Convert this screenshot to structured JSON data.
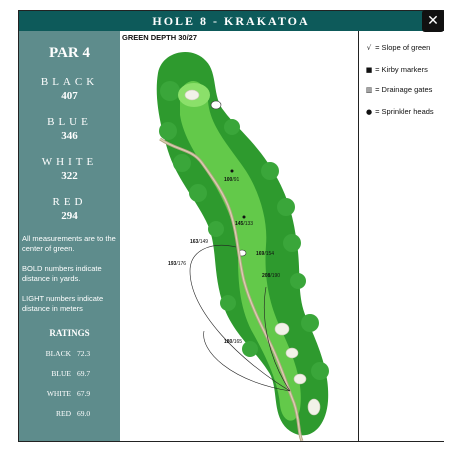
{
  "header": {
    "title": "HOLE 8 - KRAKATOA",
    "close_label": "✕"
  },
  "sidebar": {
    "par": "PAR 4",
    "tees": [
      {
        "name": "BLACK",
        "yards": "407"
      },
      {
        "name": "BLUE",
        "yards": "346"
      },
      {
        "name": "WHITE",
        "yards": "322"
      },
      {
        "name": "RED",
        "yards": "294"
      }
    ],
    "notes": [
      "All measurements are to the center of green.",
      "BOLD numbers indicate distance in yards.",
      "LIGHT numbers indicate distance in meters"
    ],
    "ratings_title": "RATINGS",
    "ratings": [
      {
        "name": "BLACK",
        "value": "72.3"
      },
      {
        "name": "BLUE",
        "value": "69.7"
      },
      {
        "name": "WHITE",
        "value": "67.9"
      },
      {
        "name": "RED",
        "value": "69.0"
      }
    ]
  },
  "map": {
    "green_depth": "GREEN DEPTH 30/27",
    "distances": [
      {
        "label": "100",
        "sub": "/91"
      },
      {
        "label": "145",
        "sub": "/133"
      },
      {
        "label": "163",
        "sub": "/149"
      },
      {
        "label": "193",
        "sub": "/176"
      },
      {
        "label": "169",
        "sub": "/154"
      },
      {
        "label": "208",
        "sub": "/190"
      },
      {
        "label": "180",
        "sub": "/165"
      }
    ]
  },
  "legend": {
    "items": [
      {
        "icon": "slope-icon",
        "symbol": "√",
        "label": "= Slope of green"
      },
      {
        "icon": "kirby-marker-icon",
        "symbol": "■",
        "label": "= Kirby markers"
      },
      {
        "icon": "drainage-gate-icon",
        "symbol": "▥",
        "label": "= Drainage gates"
      },
      {
        "icon": "sprinkler-head-icon",
        "symbol": "●",
        "label": "= Sprinkler heads"
      }
    ]
  },
  "colors": {
    "title_bar": "#0d5a5a",
    "sidebar": "#5e8c8c",
    "rough": "#2e9a2e",
    "fairway": "#63c94a",
    "sand": "#f2f2e8"
  }
}
